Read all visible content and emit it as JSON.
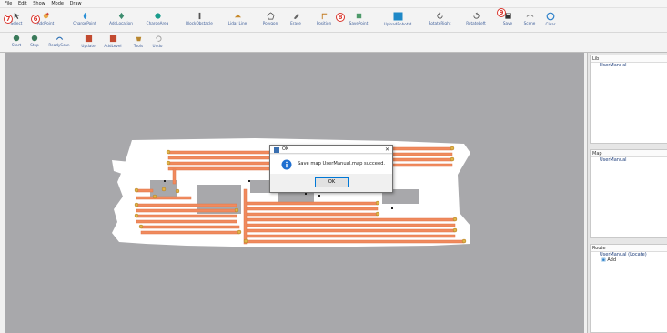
{
  "menu": [
    "File",
    "Edit",
    "Show",
    "Mode",
    "Draw"
  ],
  "toolbar1": [
    {
      "label": "Select",
      "icon": "cursor-icon"
    },
    {
      "label": "AddPoint",
      "icon": "add-point-icon"
    },
    {
      "label": "ChargePoint",
      "icon": "charge-point-icon"
    },
    {
      "label": "AddLocation",
      "icon": "location-icon"
    },
    {
      "label": "ChargeArea",
      "icon": "charge-area-icon"
    },
    {
      "label": "BlockObstacle",
      "icon": "obstacle-icon"
    },
    {
      "label": "Lidar Line",
      "icon": "lidar-line-icon"
    },
    {
      "label": "Polygon",
      "icon": "polygon-icon"
    },
    {
      "label": "Erase",
      "icon": "erase-icon"
    },
    {
      "label": "Position",
      "icon": "position-icon"
    },
    {
      "label": "SavePoint",
      "icon": "save-point-icon"
    },
    {
      "label": "UploadRobotId",
      "icon": "upload-icon"
    },
    {
      "label": "RotateRight",
      "icon": "rotate-right-icon"
    },
    {
      "label": "RotateLeft",
      "icon": "rotate-left-icon"
    },
    {
      "label": "Save",
      "icon": "save-icon"
    },
    {
      "label": "Scene",
      "icon": "scene-icon"
    },
    {
      "label": "Clear",
      "icon": "clear-icon"
    }
  ],
  "toolbar2": [
    {
      "label": "Start",
      "icon": "start-icon"
    },
    {
      "label": "Stop",
      "icon": "stop-icon"
    },
    {
      "label": "ReadyScan",
      "icon": "scan-icon"
    },
    {
      "label": "Update",
      "icon": "update-icon"
    },
    {
      "label": "AddLevel",
      "icon": "add-level-icon"
    },
    {
      "label": "Tools",
      "icon": "tools-icon"
    },
    {
      "label": "Undo",
      "icon": "undo-icon"
    }
  ],
  "badges": {
    "b7": "7",
    "b6": "6",
    "b8": "8",
    "b9": "9"
  },
  "side": {
    "panel1": {
      "title": "Lib",
      "item": "UserManual"
    },
    "panel2": {
      "title": "Map",
      "item": "UserManual"
    },
    "panel3": {
      "title": "Route",
      "item": "UserManual (Locate)",
      "sub": "Add"
    }
  },
  "dialog": {
    "title": "OK",
    "message": "Save map UserManual.map succeed.",
    "ok": "OK",
    "close": "✕"
  },
  "colors": {
    "path": "#f08a5e",
    "node": "#e0b34a",
    "canvas": "#a8a8ab",
    "badge": "#d9342b"
  }
}
